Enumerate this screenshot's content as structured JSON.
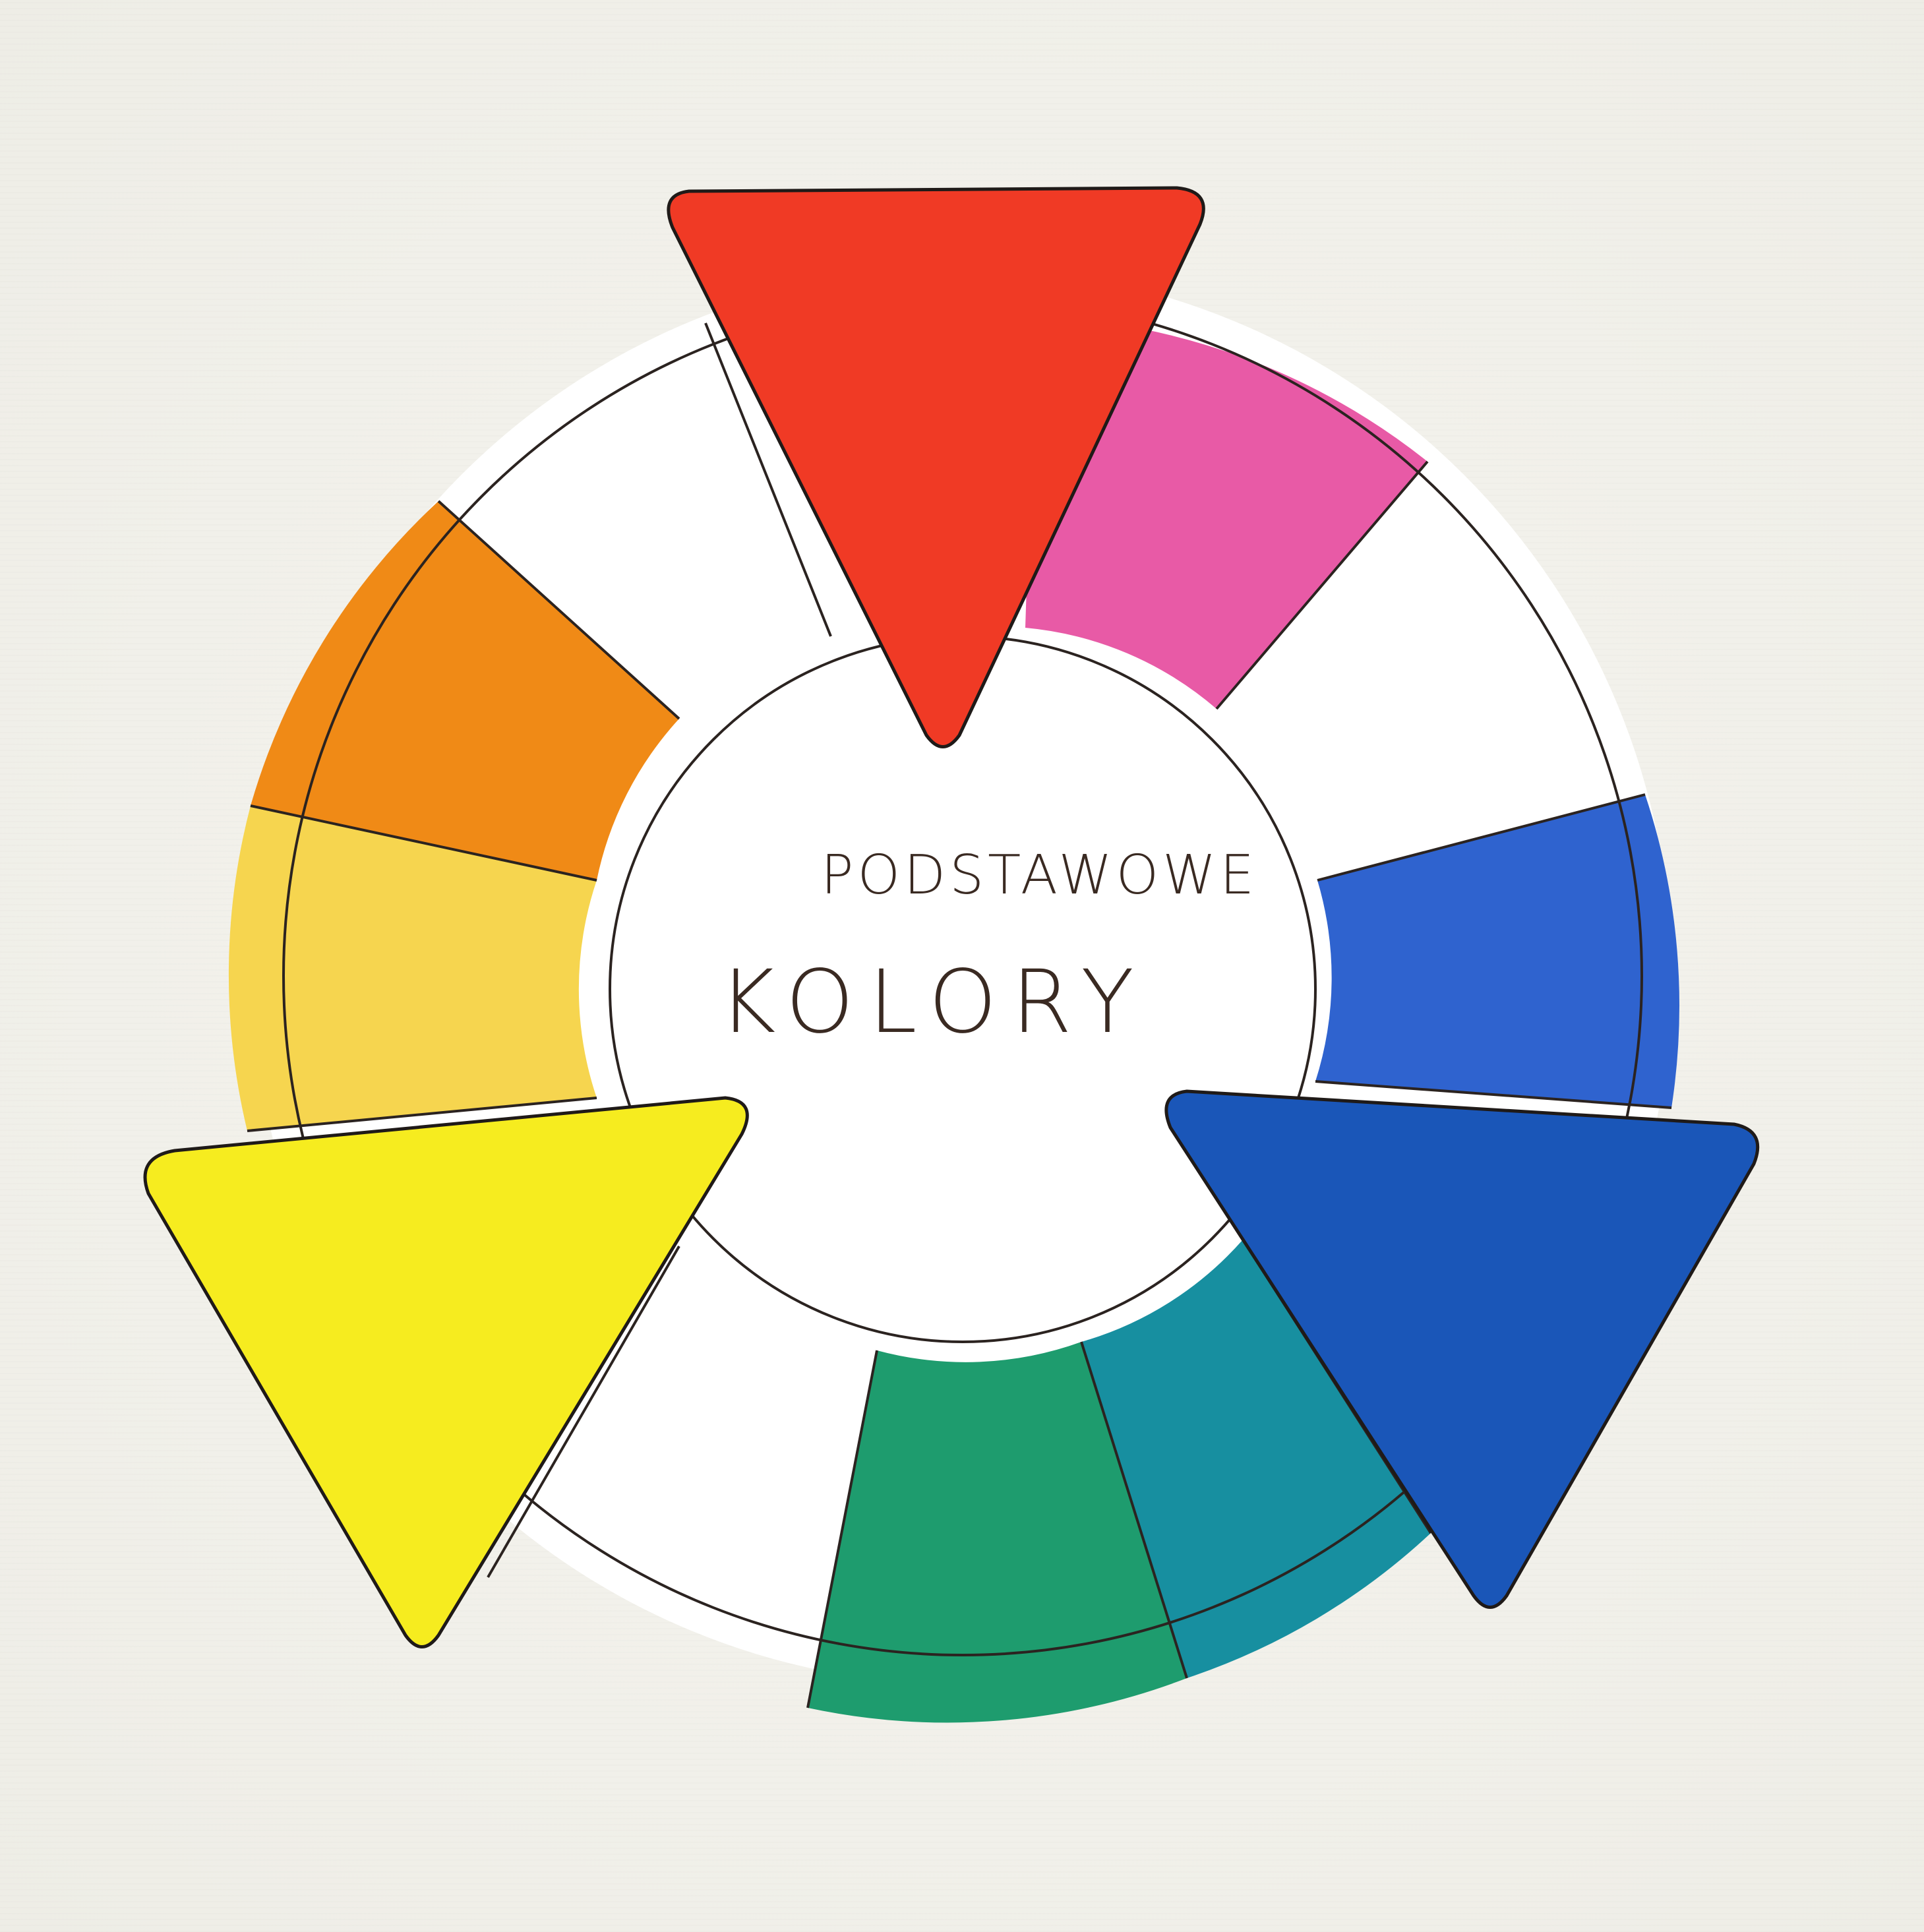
{
  "diagram": {
    "title_top": "PODSTAWOWE",
    "title_main": "KOLORY",
    "primary_colors": [
      {
        "id": "red",
        "color": "#f03a25"
      },
      {
        "id": "yellow",
        "color": "#f6ec1f"
      },
      {
        "id": "blue",
        "color": "#1a56b8"
      }
    ],
    "secondary_segments": [
      {
        "id": "magenta",
        "color": "#e85aa6"
      },
      {
        "id": "blue-violet",
        "color": "#2f63cf"
      },
      {
        "id": "teal",
        "color": "#178fa0"
      },
      {
        "id": "green",
        "color": "#1e9c6e"
      },
      {
        "id": "yellow-light",
        "color": "#f6d54f"
      },
      {
        "id": "orange",
        "color": "#f08a16"
      }
    ],
    "empty_segment_color": "#ffffff"
  }
}
